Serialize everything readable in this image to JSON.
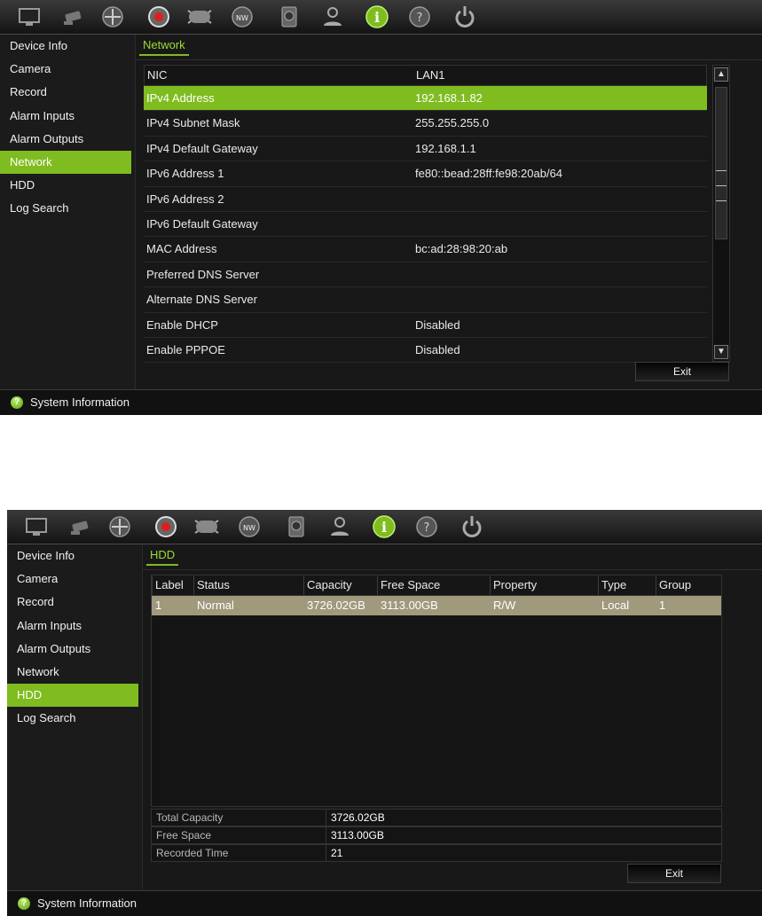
{
  "toolbar": {
    "icons": [
      "monitor-icon",
      "camera-icon",
      "ptz-icon",
      "record-icon",
      "alarm-icon",
      "network-icon",
      "hdd-icon",
      "user-icon",
      "info-icon",
      "help-icon",
      "power-icon"
    ]
  },
  "sidebar": {
    "items": [
      "Device Info",
      "Camera",
      "Record",
      "Alarm Inputs",
      "Alarm Outputs",
      "Network",
      "HDD",
      "Log Search"
    ]
  },
  "status_bar": {
    "text": "System Information"
  },
  "screen1": {
    "tab": "Network",
    "active_item": "Network",
    "header": {
      "label": "NIC",
      "value": "LAN1"
    },
    "rows": [
      {
        "label": "IPv4 Address",
        "value": "192.168.1.82",
        "selected": true
      },
      {
        "label": "IPv4 Subnet Mask",
        "value": "255.255.255.0"
      },
      {
        "label": "IPv4 Default Gateway",
        "value": "192.168.1.1"
      },
      {
        "label": "IPv6 Address 1",
        "value": "fe80::bead:28ff:fe98:20ab/64"
      },
      {
        "label": "IPv6 Address 2",
        "value": ""
      },
      {
        "label": "IPv6 Default Gateway",
        "value": ""
      },
      {
        "label": "MAC Address",
        "value": "bc:ad:28:98:20:ab"
      },
      {
        "label": "Preferred DNS Server",
        "value": ""
      },
      {
        "label": "Alternate DNS Server",
        "value": ""
      },
      {
        "label": "Enable DHCP",
        "value": "Disabled"
      },
      {
        "label": "Enable PPPOE",
        "value": "Disabled"
      }
    ],
    "exit_label": "Exit"
  },
  "screen2": {
    "tab": "HDD",
    "active_item": "HDD",
    "columns": [
      "Label",
      "Status",
      "Capacity",
      "Free Space",
      "Property",
      "Type",
      "Group"
    ],
    "rows": [
      [
        "1",
        "Normal",
        "3726.02GB",
        "3113.00GB",
        "R/W",
        "Local",
        "1"
      ]
    ],
    "summary": [
      {
        "label": "Total Capacity",
        "value": "3726.02GB"
      },
      {
        "label": "Free Space",
        "value": "3113.00GB"
      },
      {
        "label": "Recorded Time",
        "value": "21"
      }
    ],
    "exit_label": "Exit"
  },
  "colors": {
    "accent": "#7fbc20",
    "selected_row": "#a0997c",
    "background": "#1b1b1b"
  }
}
